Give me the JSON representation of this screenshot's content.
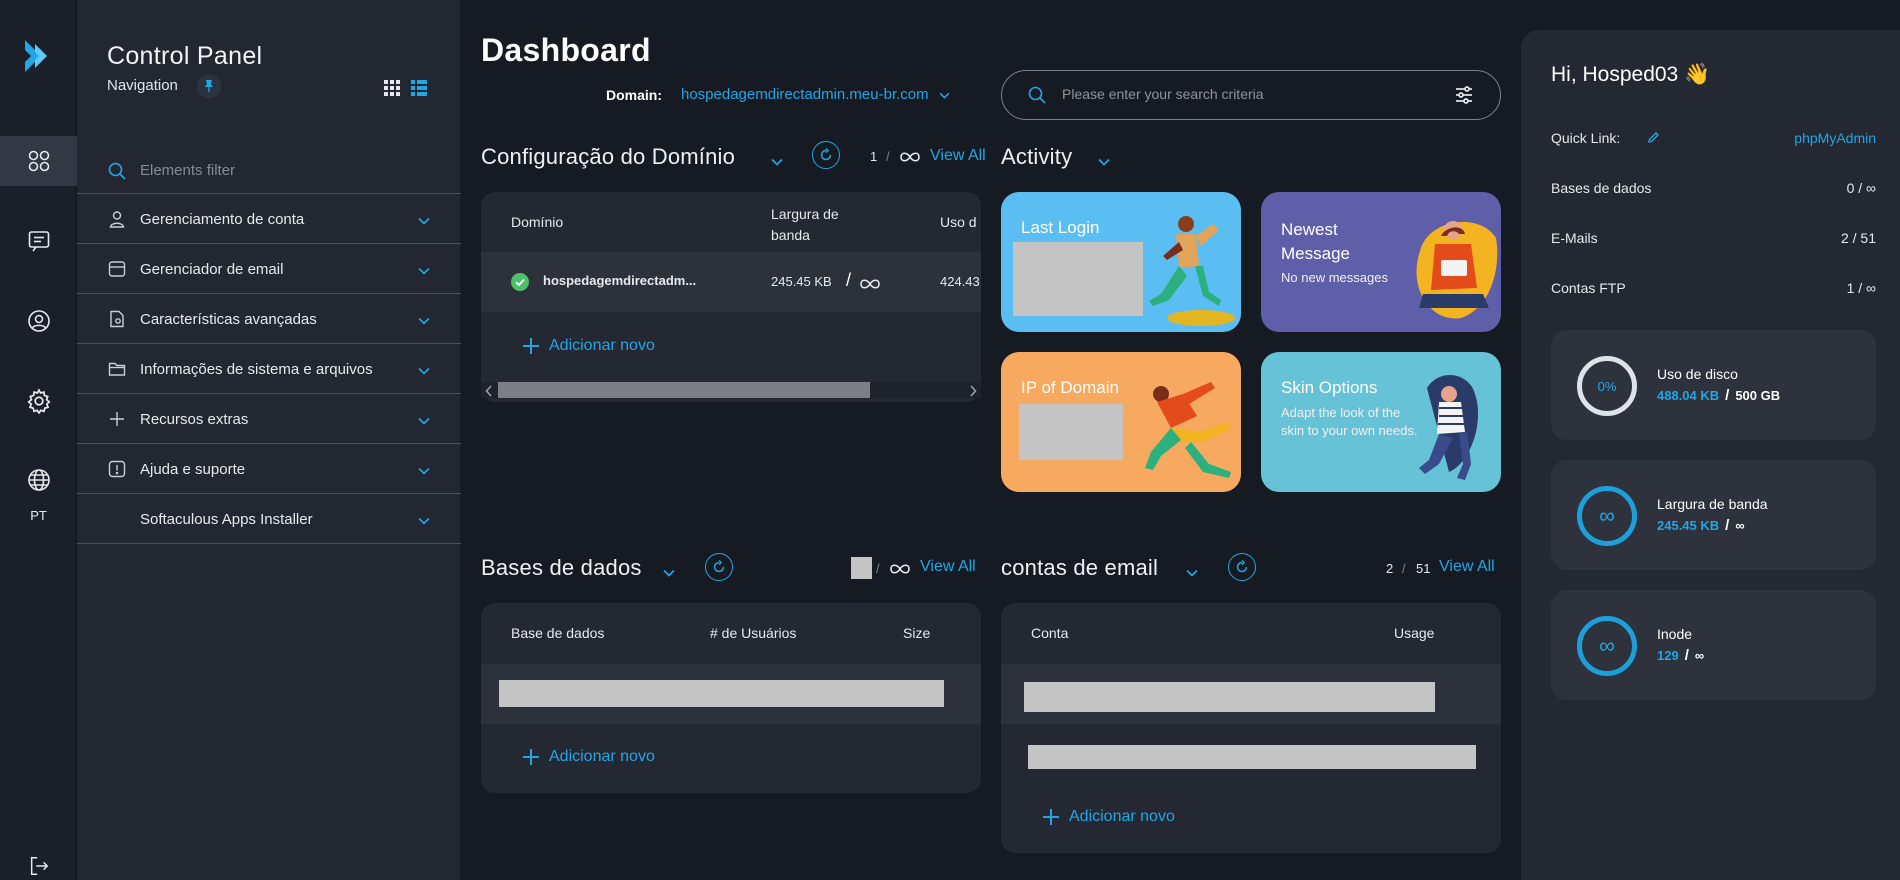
{
  "nav": {
    "title": "Control Panel",
    "subtitle": "Navigation",
    "filter_placeholder": "Elements filter",
    "items": [
      {
        "label": "Gerenciamento de conta",
        "icon": "user-icon"
      },
      {
        "label": "Gerenciador de email",
        "icon": "mail-icon"
      },
      {
        "label": "Características avançadas",
        "icon": "advanced-icon"
      },
      {
        "label": "Informações de sistema e arquivos",
        "icon": "folder-icon"
      },
      {
        "label": "Recursos extras",
        "icon": "plus-icon"
      },
      {
        "label": "Ajuda e suporte",
        "icon": "help-icon"
      },
      {
        "label": "Softaculous Apps Installer",
        "icon": ""
      }
    ]
  },
  "rail": {
    "lang": "PT",
    "items": [
      "dashboard-icon",
      "chat-icon",
      "account-icon",
      "settings-icon",
      "globe-icon",
      "logout-icon"
    ]
  },
  "header": {
    "title": "Dashboard",
    "domain_label": "Domain:",
    "domain_value": "hospedagemdirectadmin.meu-br.com",
    "search_placeholder": "Please enter your search criteria"
  },
  "domain_section": {
    "title": "Configuração do Domínio",
    "count": "1",
    "sep": "/",
    "view_all": "View All",
    "columns": [
      "Domínio",
      "Largura de banda",
      "Uso d"
    ],
    "row": {
      "domain": "hospedagemdirectadm...",
      "bandwidth": "245.45 KB",
      "bandwidth_sep": "/",
      "usage": "424.43"
    },
    "add_new": "Adicionar novo"
  },
  "activity": {
    "title": "Activity",
    "tiles": [
      {
        "title": "Last Login",
        "text": "",
        "color": "#5bbef2"
      },
      {
        "title": "Newest Message",
        "text": "No new messages",
        "color": "#5e5fa8"
      },
      {
        "title": "IP of Domain",
        "text": "",
        "color": "#f6a95f"
      },
      {
        "title": "Skin Options",
        "text": "Adapt the look of the skin to your own needs.",
        "color": "#66c2d6"
      }
    ]
  },
  "db_section": {
    "title": "Bases de dados",
    "sep": "/",
    "view_all": "View All",
    "columns": [
      "Base de dados",
      "# de Usuários",
      "Size"
    ],
    "add_new": "Adicionar novo"
  },
  "email_section": {
    "title": "contas de email",
    "count": "2",
    "sep": "/",
    "total": "51",
    "view_all": "View All",
    "columns": [
      "Conta",
      "Usage"
    ],
    "add_new": "Adicionar novo"
  },
  "right": {
    "greeting": "Hi, Hosped03 👋",
    "quick_link_label": "Quick Link:",
    "quick_link_value": "phpMyAdmin",
    "stats": [
      {
        "label": "Bases de dados",
        "value": "0 / ∞"
      },
      {
        "label": "E-Mails",
        "value": "2 / 51"
      },
      {
        "label": "Contas FTP",
        "value": "1 / ∞"
      }
    ],
    "cards": [
      {
        "name": "Uso de disco",
        "ring": "0%",
        "used": "488.04 KB",
        "sep": "/",
        "limit": "500 GB"
      },
      {
        "name": "Largura de banda",
        "ring": "∞",
        "used": "245.45 KB",
        "sep": "/",
        "limit": "∞"
      },
      {
        "name": "Inode",
        "ring": "∞",
        "used": "129",
        "sep": "/",
        "limit": "∞"
      }
    ]
  },
  "colors": {
    "accent": "#22a6e6",
    "success": "#4cc06a",
    "background": "#161a22",
    "panel": "#232731"
  }
}
